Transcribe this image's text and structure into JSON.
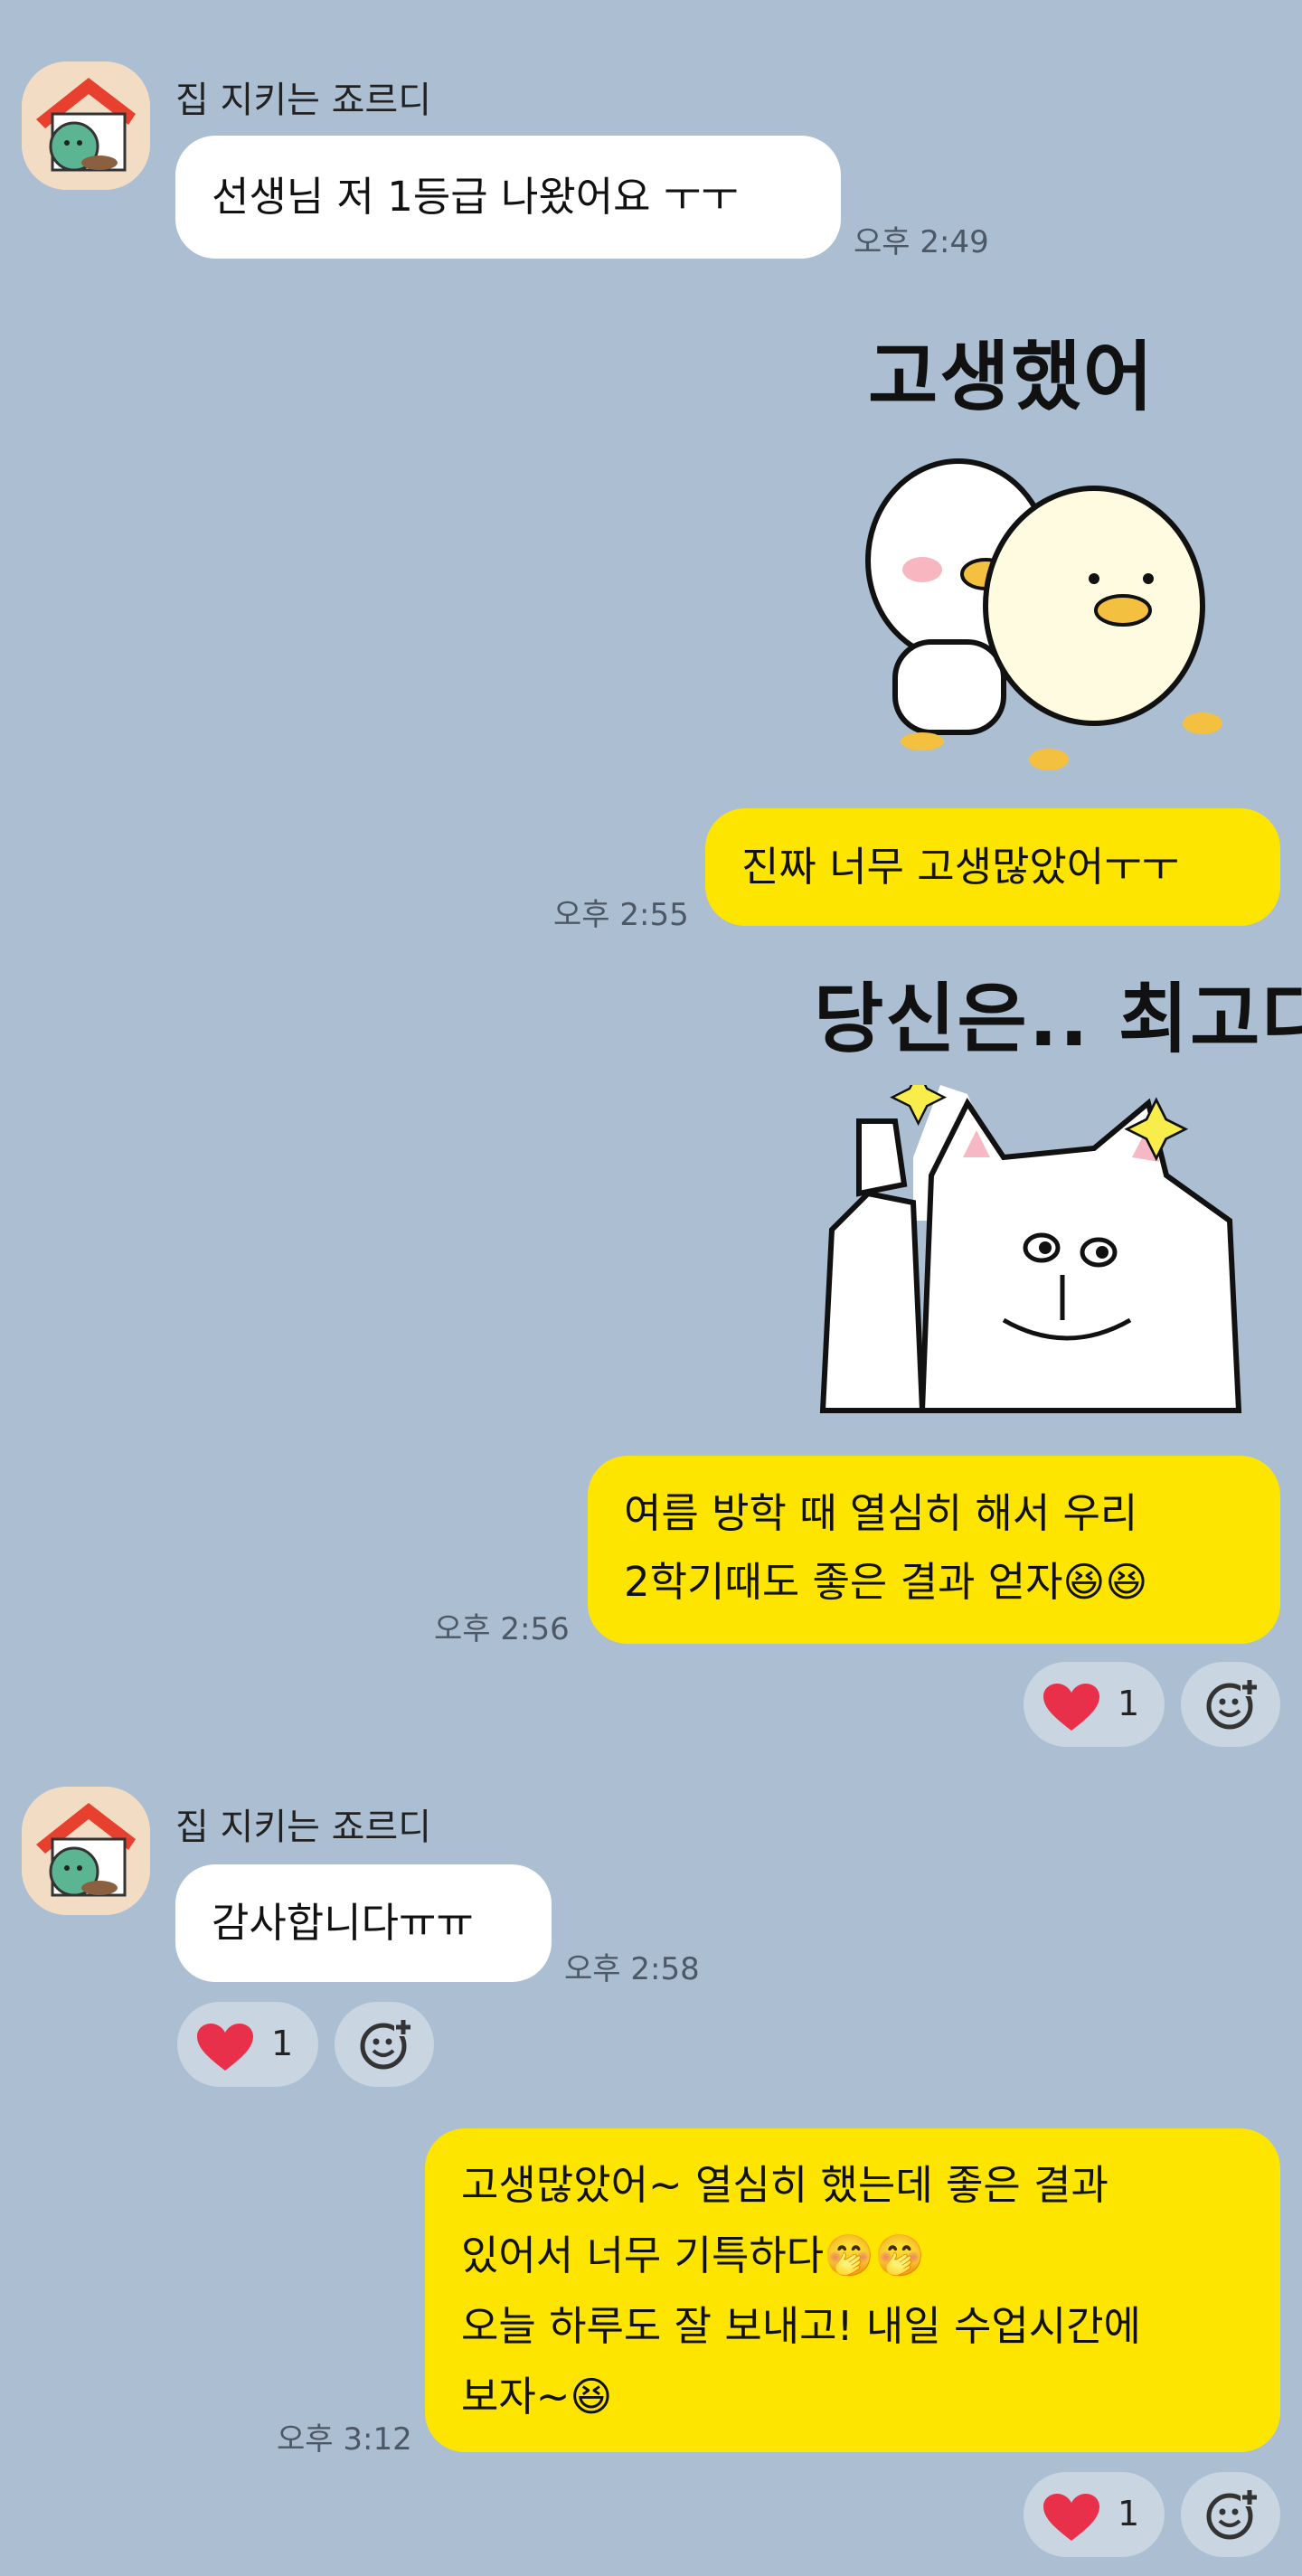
{
  "messages": [
    {
      "sender": "집 지키는 죠르디",
      "text": "선생님 저 1등급 나왔어요 ㅜㅜ",
      "time": "오후 2:49"
    },
    {
      "sticker_caption": "고생했어"
    },
    {
      "text": "진짜 너무 고생많았어ㅜㅜ",
      "time": "오후 2:55"
    },
    {
      "sticker_caption": "당신은.. 최고다"
    },
    {
      "lines": [
        "여름 방학 때 열심히 해서 우리",
        "2학기때도 좋은 결과 얻자😆😆"
      ],
      "time": "오후 2:56",
      "reaction_count": "1"
    },
    {
      "sender": "집 지키는 죠르디",
      "text": "감사합니다ㅠㅠ",
      "time": "오후 2:58",
      "reaction_count": "1"
    },
    {
      "lines": [
        "고생많았어~ 열심히 했는데 좋은 결과",
        "있어서 너무 기특하다🤭🤭",
        "오늘 하루도 잘 보내고! 내일 수업시간에",
        "보자~😆"
      ],
      "time": "오후 3:12",
      "reaction_count": "1"
    }
  ],
  "colors": {
    "background": "#abbed2",
    "outgoing_bubble": "#fee500",
    "incoming_bubble": "#ffffff",
    "heart": "#e8304a"
  },
  "icons": {
    "reaction": "heart-icon",
    "add_reaction": "add-emoji-icon",
    "avatar": "dog-house-avatar"
  }
}
